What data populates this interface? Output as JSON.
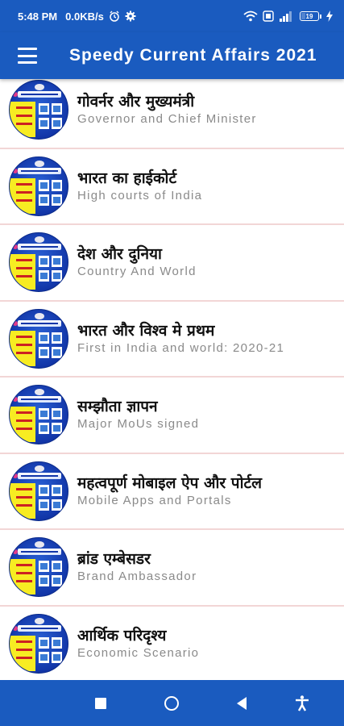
{
  "status_bar": {
    "time": "5:48 PM",
    "net_speed": "0.0KB/s",
    "battery_level": "19",
    "icons": [
      "alarm-icon",
      "settings-icon",
      "wifi-icon",
      "data-icon",
      "signal-icon",
      "battery-icon",
      "charging-icon"
    ]
  },
  "app_bar": {
    "title": "Speedy Current Affairs 2021",
    "menu_icon": "menu-icon",
    "background_color": "#1a5bbf"
  },
  "items": [
    {
      "title_hi": "गोवर्नर और मुख्यमंत्री",
      "title_en": "Governor and Chief Minister"
    },
    {
      "title_hi": "भारत का हाईकोर्ट",
      "title_en": "High courts of India"
    },
    {
      "title_hi": "देश और दुनिया",
      "title_en": "Country And World"
    },
    {
      "title_hi": "भारत और विश्व मे प्रथम",
      "title_en": "First in India and world: 2020-21"
    },
    {
      "title_hi": "सम्झौता ज्ञापन",
      "title_en": "Major MoUs signed"
    },
    {
      "title_hi": "महत्वपूर्ण मोबाइल ऐप और पोर्टल",
      "title_en": "Mobile Apps and Portals"
    },
    {
      "title_hi": "ब्रांड एम्बेसडर",
      "title_en": "Brand Ambassador"
    },
    {
      "title_hi": "आर्थिक परिदृश्य",
      "title_en": "Economic Scenario"
    }
  ],
  "nav_bar": {
    "buttons": [
      "recents-icon",
      "home-icon",
      "back-icon",
      "accessibility-icon"
    ]
  },
  "colors": {
    "accent": "#1a5bbf",
    "divider": "#f2d6d6",
    "subtitle": "#8a8a8a"
  }
}
